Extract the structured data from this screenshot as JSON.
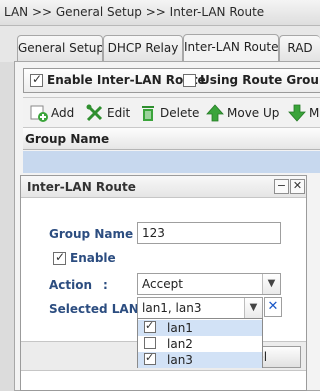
{
  "breadcrumb": "LAN >> General Setup >> Inter-LAN Route",
  "tabs": [
    {
      "label": "General Setup"
    },
    {
      "label": "DHCP Relay"
    },
    {
      "label": "Inter-LAN Route"
    },
    {
      "label": "RAD"
    }
  ],
  "options": {
    "enable_inter_lan_route": {
      "label": "Enable Inter-LAN Route",
      "checked": true
    },
    "using_route_group": {
      "label": "Using Route Group",
      "checked": false
    }
  },
  "toolbar": {
    "add": "Add",
    "edit": "Edit",
    "delete": "Delete",
    "move_up": "Move Up",
    "move_down": "Move"
  },
  "grid": {
    "columns": [
      "Group Name"
    ]
  },
  "dialog": {
    "title": "Inter-LAN Route",
    "group_name_label": "Group Name :",
    "group_name_value": "123",
    "enable_label": "Enable",
    "enable_checked": true,
    "action_label": "Action",
    "action_colon": ":",
    "action_value": "Accept",
    "selected_lans_label": "Selected LANs :",
    "selected_lans_value": "lan1, lan3",
    "cancel_label": "ancel"
  },
  "lan_options": [
    {
      "label": "lan1",
      "checked": true
    },
    {
      "label": "lan2",
      "checked": false
    },
    {
      "label": "lan3",
      "checked": true
    }
  ],
  "colors": {
    "accent_label": "#2c4d80",
    "selected_row": "#c7d8ee",
    "clear_icon": "#1a57c7"
  }
}
